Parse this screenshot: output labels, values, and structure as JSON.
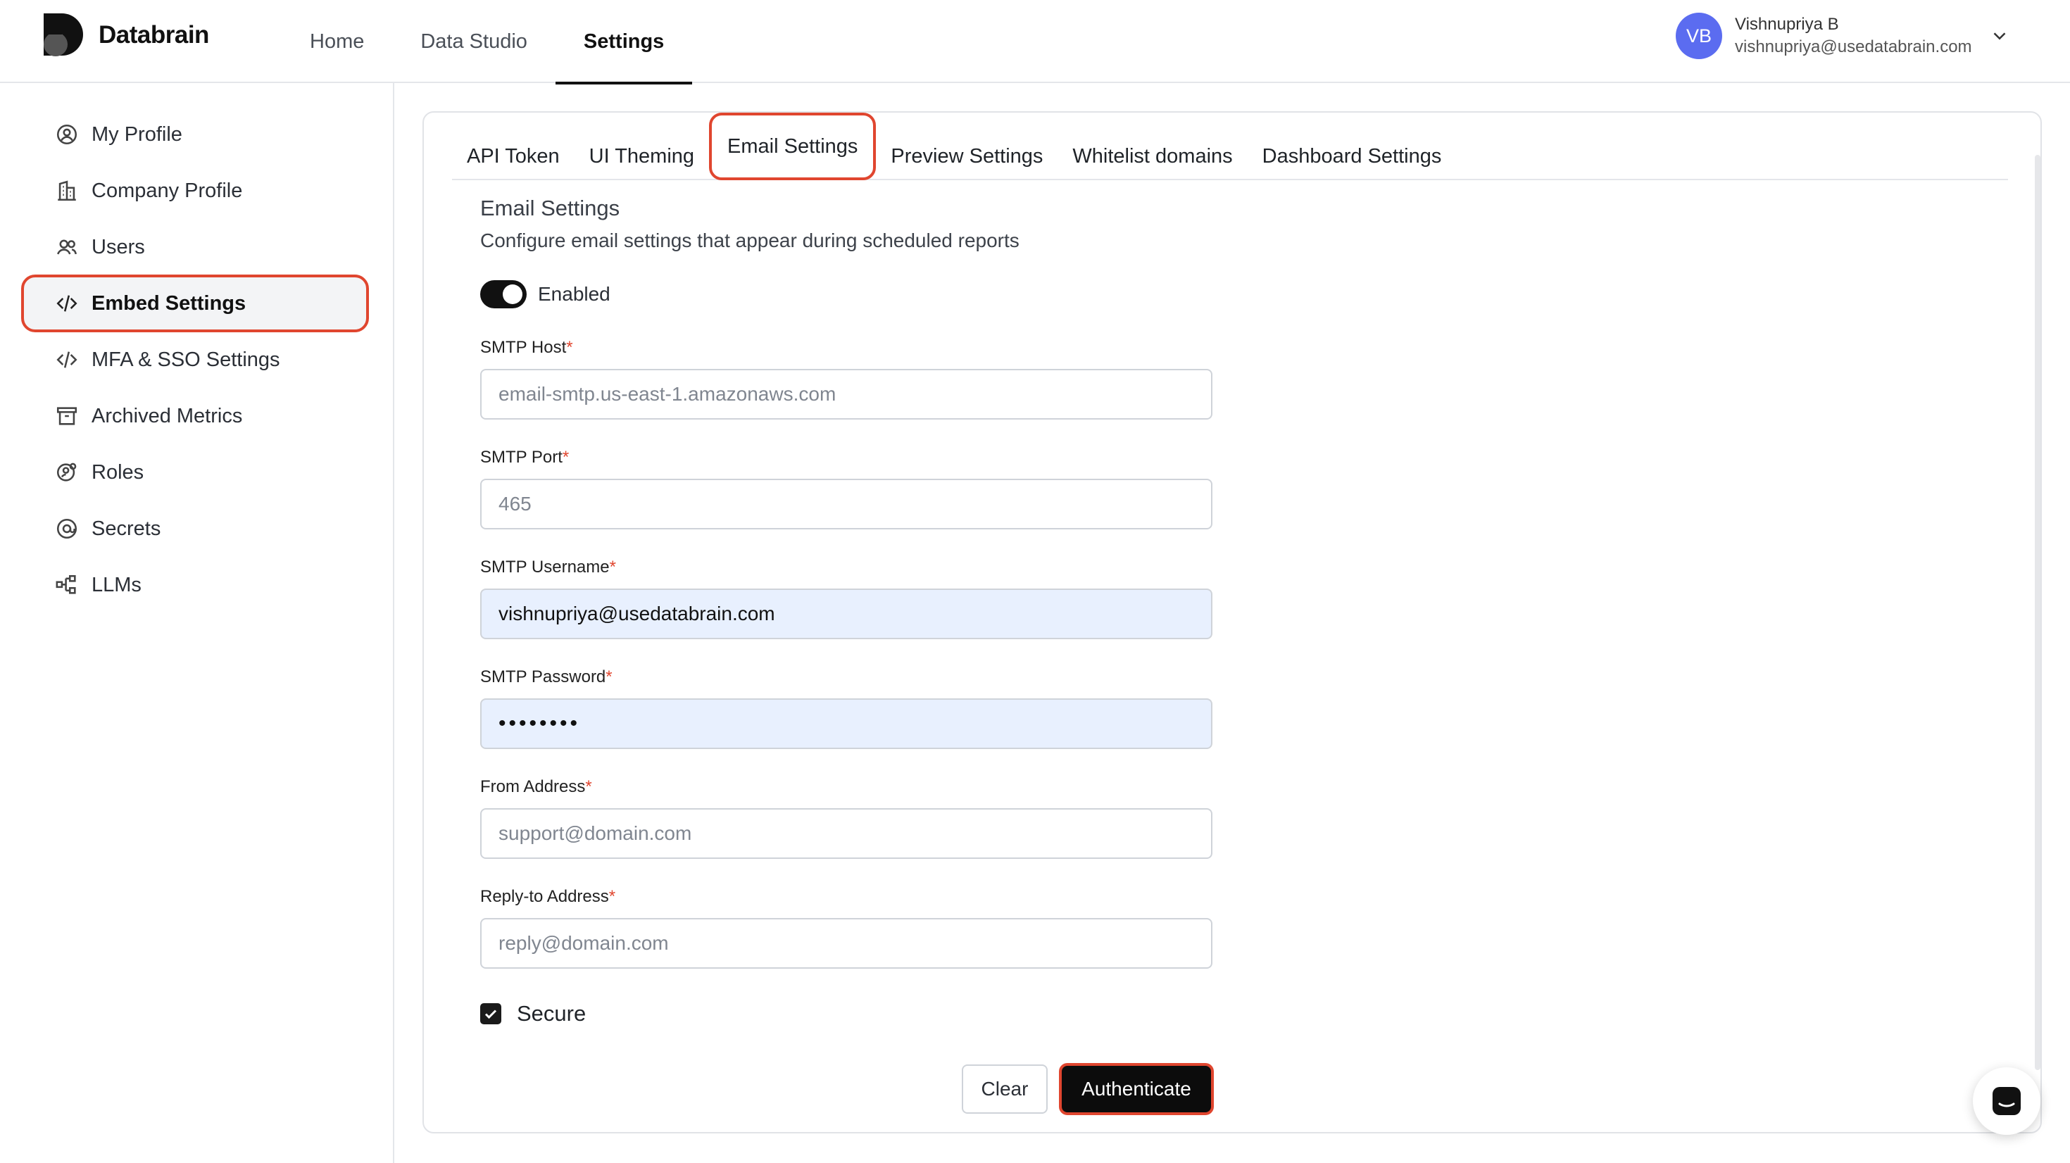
{
  "brand": {
    "name": "Databrain"
  },
  "topnav": {
    "items": [
      "Home",
      "Data Studio",
      "Settings"
    ],
    "active": "Settings"
  },
  "user": {
    "initials": "VB",
    "name": "Vishnupriya B",
    "email": "vishnupriya@usedatabrain.com"
  },
  "sidebar": {
    "items": [
      {
        "label": "My Profile",
        "icon": "user-circle-icon"
      },
      {
        "label": "Company Profile",
        "icon": "building-icon"
      },
      {
        "label": "Users",
        "icon": "users-icon"
      },
      {
        "label": "Embed Settings",
        "icon": "code-icon"
      },
      {
        "label": "MFA & SSO Settings",
        "icon": "code-icon"
      },
      {
        "label": "Archived Metrics",
        "icon": "archive-icon"
      },
      {
        "label": "Roles",
        "icon": "user-gear-icon"
      },
      {
        "label": "Secrets",
        "icon": "at-sign-icon"
      },
      {
        "label": "LLMs",
        "icon": "network-icon"
      }
    ],
    "active": "Embed Settings"
  },
  "tabs": {
    "items": [
      "API Token",
      "UI Theming",
      "Email Settings",
      "Preview Settings",
      "Whitelist domains",
      "Dashboard Settings"
    ],
    "active": "Email Settings"
  },
  "email_settings": {
    "title": "Email Settings",
    "description": "Configure email settings that appear during scheduled reports",
    "enabled_label": "Enabled",
    "enabled": true,
    "fields": {
      "smtp_host": {
        "label": "SMTP Host",
        "required_mark": "*",
        "value": "",
        "placeholder": "email-smtp.us-east-1.amazonaws.com"
      },
      "smtp_port": {
        "label": "SMTP Port",
        "required_mark": "*",
        "value": "",
        "placeholder": "465"
      },
      "smtp_username": {
        "label": "SMTP Username",
        "required_mark": "*",
        "value": "vishnupriya@usedatabrain.com",
        "placeholder": ""
      },
      "smtp_password": {
        "label": "SMTP Password",
        "required_mark": "*",
        "value": "••••••••",
        "placeholder": ""
      },
      "from_address": {
        "label": "From Address",
        "required_mark": "*",
        "value": "",
        "placeholder": "support@domain.com"
      },
      "reply_to_address": {
        "label": "Reply-to Address",
        "required_mark": "*",
        "value": "",
        "placeholder": "reply@domain.com"
      }
    },
    "secure_label": "Secure",
    "secure_checked": true,
    "clear_label": "Clear",
    "authenticate_label": "Authenticate"
  },
  "colors": {
    "accent_outline": "#e0462f",
    "avatar": "#5b6cf0",
    "autofill": "#e8f0fe"
  }
}
